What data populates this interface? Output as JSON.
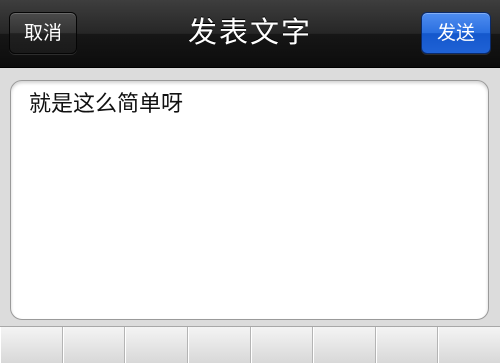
{
  "navbar": {
    "cancel_label": "取消",
    "title": "发表文字",
    "send_label": "发送"
  },
  "editor": {
    "text": "就是这么简单呀"
  },
  "toolbar": {
    "cells": [
      "",
      "",
      "",
      "",
      "",
      "",
      "",
      ""
    ]
  },
  "colors": {
    "send_button": "#2a6fe0",
    "navbar": "#1e1e1e"
  }
}
